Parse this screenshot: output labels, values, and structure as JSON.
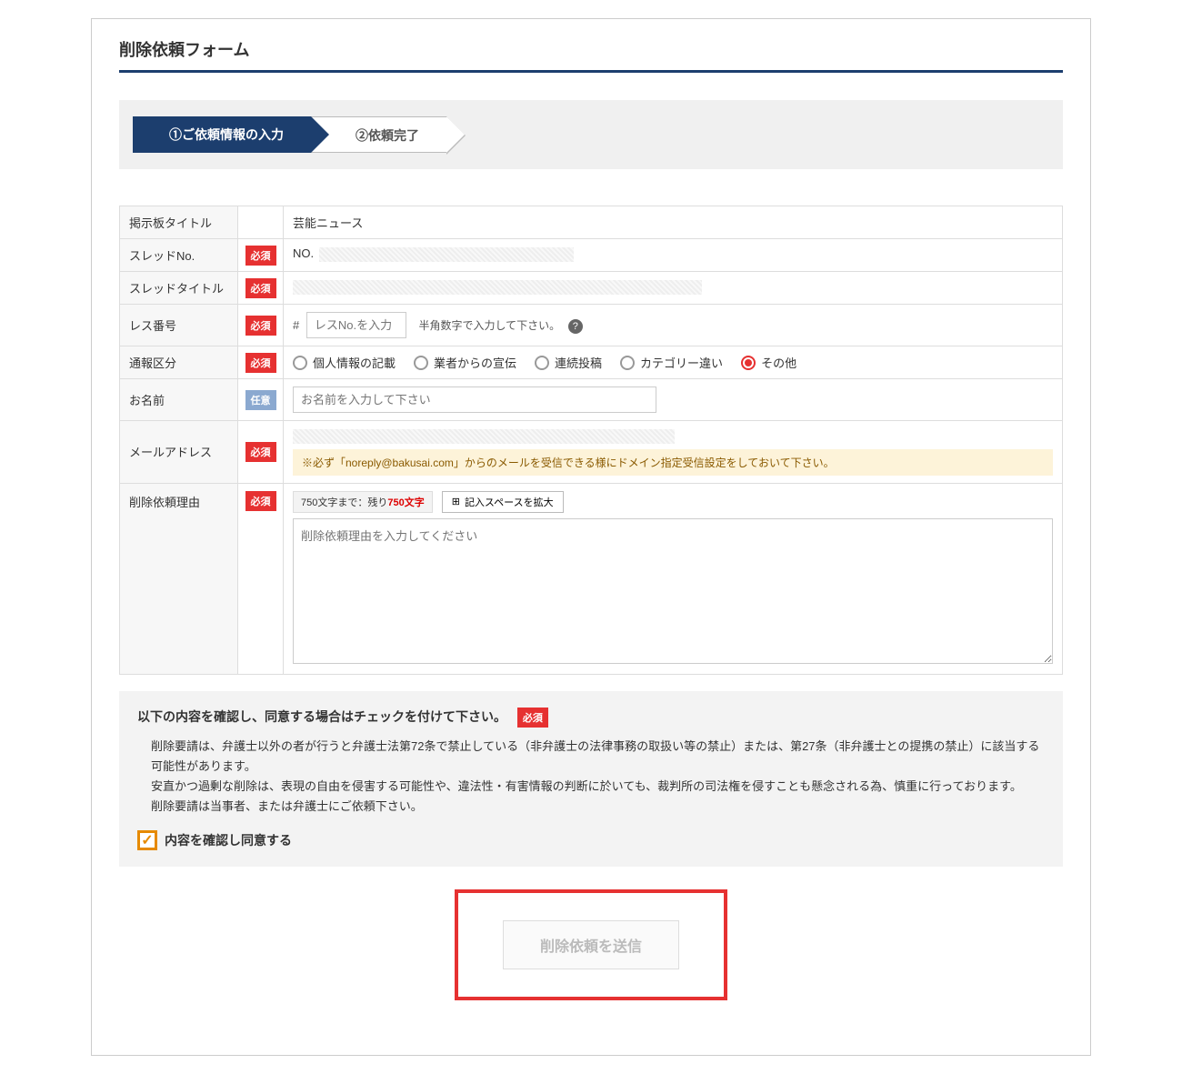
{
  "page_title": "削除依頼フォーム",
  "progress": {
    "step1": "①ご依頼情報の入力",
    "step2": "②依頼完了"
  },
  "badges": {
    "required": "必須",
    "optional": "任意"
  },
  "form": {
    "board_title": {
      "label": "掲示板タイトル",
      "value": "芸能ニュース"
    },
    "thread_no": {
      "label": "スレッドNo.",
      "prefix": "NO."
    },
    "thread_title": {
      "label": "スレッドタイトル"
    },
    "res_no": {
      "label": "レス番号",
      "hash": "#",
      "placeholder": "レスNo.を入力",
      "hint": "半角数字で入力して下さい。"
    },
    "report_type": {
      "label": "通報区分",
      "options": [
        "個人情報の記載",
        "業者からの宣伝",
        "連続投稿",
        "カテゴリー違い",
        "その他"
      ],
      "selected_index": 4
    },
    "name": {
      "label": "お名前",
      "placeholder": "お名前を入力して下さい"
    },
    "email": {
      "label": "メールアドレス",
      "note": "※必ず「noreply@bakusai.com」からのメールを受信できる様にドメイン指定受信設定をしておいて下さい。"
    },
    "reason": {
      "label": "削除依頼理由",
      "char_count_prefix": "750文字まで：残り",
      "char_count_value": "750文字",
      "expand_label": "記入スペースを拡大",
      "placeholder": "削除依頼理由を入力してください"
    }
  },
  "agreement": {
    "heading": "以下の内容を確認し、同意する場合はチェックを付けて下さい。",
    "body": "削除要請は、弁護士以外の者が行うと弁護士法第72条で禁止している（非弁護士の法律事務の取扱い等の禁止）または、第27条（非弁護士との提携の禁止）に該当する可能性があります。\n安直かつ過剰な削除は、表現の自由を侵害する可能性や、違法性・有害情報の判断に於いても、裁判所の司法権を侵すことも懸念される為、慎重に行っております。\n削除要請は当事者、または弁護士にご依頼下さい。",
    "check_label": "内容を確認し同意する"
  },
  "submit": {
    "label": "削除依頼を送信"
  }
}
